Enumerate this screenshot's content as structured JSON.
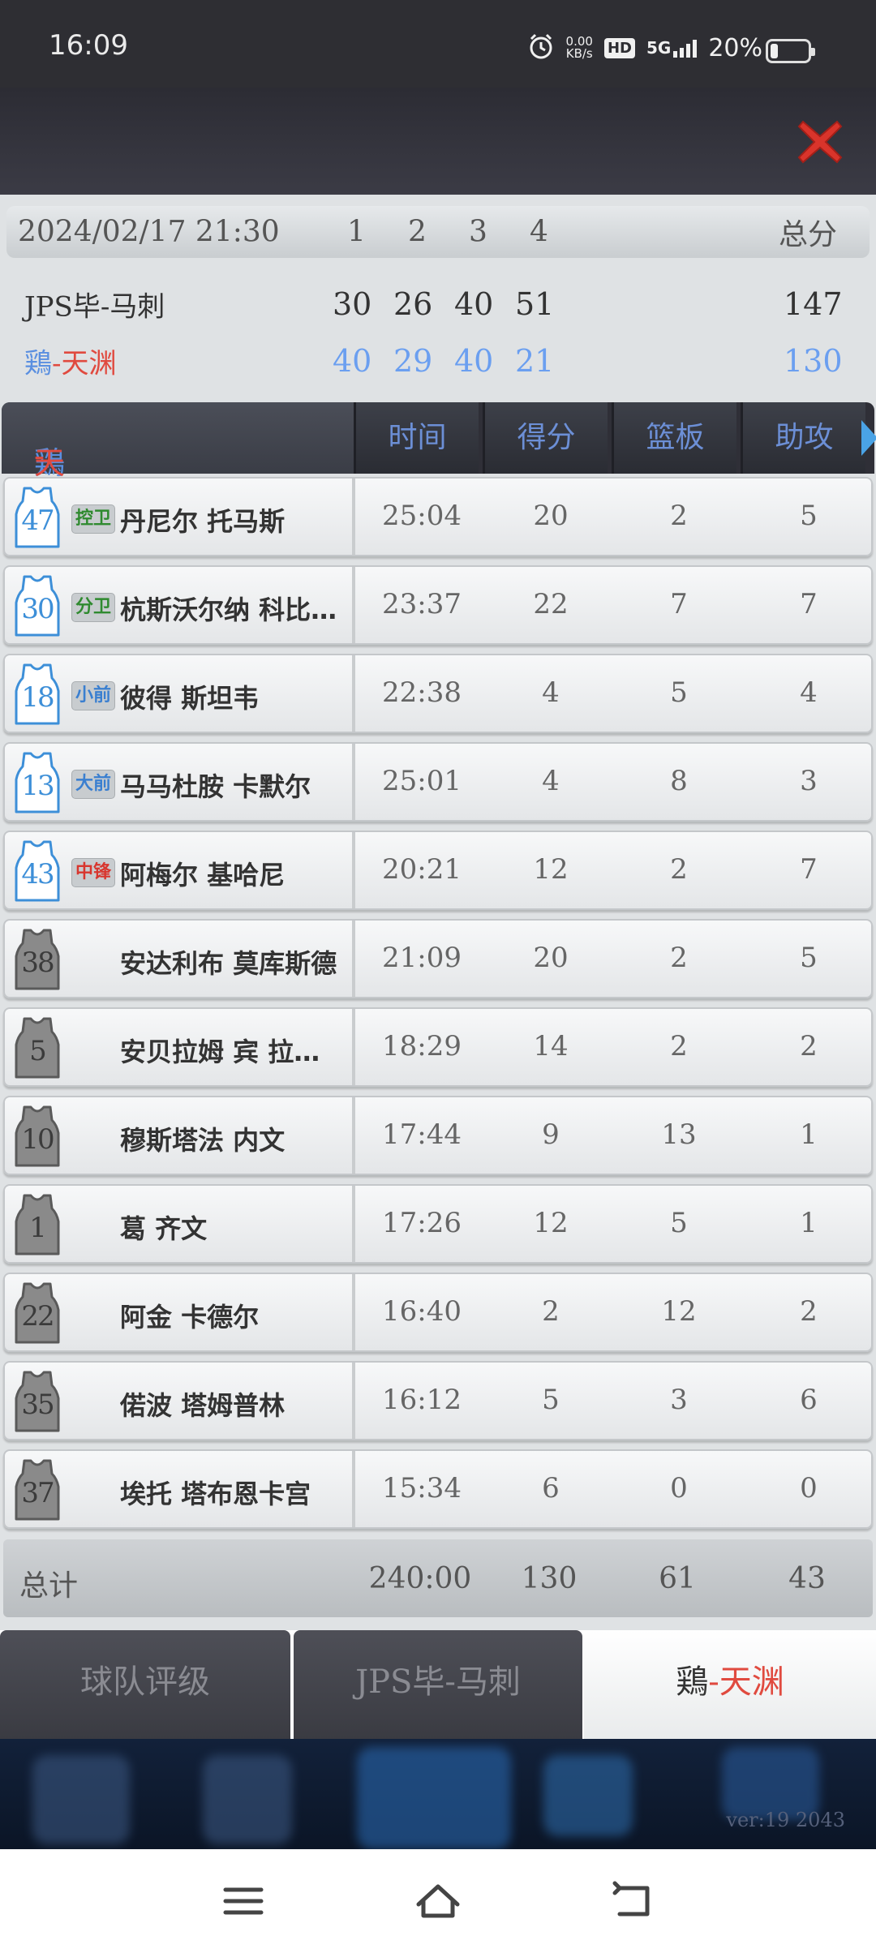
{
  "status_bar": {
    "time": "16:09",
    "net_speed_value": "0.00",
    "net_speed_unit": "KB/s",
    "hd_label": "HD",
    "network": "5G",
    "battery_text": "20%",
    "battery_level": 0.2
  },
  "scoreboard": {
    "datetime": "2024/02/17 21:30",
    "quarters": [
      "1",
      "2",
      "3",
      "4"
    ],
    "total_label": "总分",
    "team_a": {
      "prefix": "JPS毕",
      "sep": "-",
      "name": "马刺",
      "q": [
        "30",
        "26",
        "40",
        "51"
      ],
      "total": "147"
    },
    "team_b": {
      "prefix": "鶏",
      "sep": "-",
      "name": "天渊",
      "q": [
        "40",
        "29",
        "40",
        "21"
      ],
      "total": "130"
    }
  },
  "table": {
    "team_prefix": "鶏",
    "team_sep": "-",
    "team_name": "天渊",
    "columns": [
      "时间",
      "得分",
      "篮板",
      "助攻"
    ],
    "players": [
      {
        "number": "47",
        "pos": "控卫",
        "name": "丹尼尔  托马斯",
        "time": "25:04",
        "pts": "20",
        "reb": "2",
        "ast": "5"
      },
      {
        "number": "30",
        "pos": "分卫",
        "name": "杭斯沃尔纳  科比…",
        "time": "23:37",
        "pts": "22",
        "reb": "7",
        "ast": "7"
      },
      {
        "number": "18",
        "pos": "小前",
        "name": "彼得  斯坦韦",
        "time": "22:38",
        "pts": "4",
        "reb": "5",
        "ast": "4"
      },
      {
        "number": "13",
        "pos": "大前",
        "name": "马马杜胺  卡默尔",
        "time": "25:01",
        "pts": "4",
        "reb": "8",
        "ast": "3"
      },
      {
        "number": "43",
        "pos": "中锋",
        "name": "阿梅尔  基哈尼",
        "time": "20:21",
        "pts": "12",
        "reb": "2",
        "ast": "7"
      },
      {
        "number": "38",
        "pos": "",
        "name": "安达利布  莫库斯德",
        "time": "21:09",
        "pts": "20",
        "reb": "2",
        "ast": "5"
      },
      {
        "number": "5",
        "pos": "",
        "name": "安贝拉姆  宾  拉…",
        "time": "18:29",
        "pts": "14",
        "reb": "2",
        "ast": "2"
      },
      {
        "number": "10",
        "pos": "",
        "name": "穆斯塔法  内文",
        "time": "17:44",
        "pts": "9",
        "reb": "13",
        "ast": "1"
      },
      {
        "number": "1",
        "pos": "",
        "name": "葛  齐文",
        "time": "17:26",
        "pts": "12",
        "reb": "5",
        "ast": "1"
      },
      {
        "number": "22",
        "pos": "",
        "name": "阿金  卡德尔",
        "time": "16:40",
        "pts": "2",
        "reb": "12",
        "ast": "2"
      },
      {
        "number": "35",
        "pos": "",
        "name": "偌波  塔姆普林",
        "time": "16:12",
        "pts": "5",
        "reb": "3",
        "ast": "6"
      },
      {
        "number": "37",
        "pos": "",
        "name": "埃托  塔布恩卡宫",
        "time": "15:34",
        "pts": "6",
        "reb": "0",
        "ast": "0"
      }
    ],
    "totals": {
      "label": "总计",
      "time": "240:00",
      "pts": "130",
      "reb": "61",
      "ast": "43"
    }
  },
  "tabs": {
    "team_rating": "球队评级",
    "team_a_prefix": "JPS毕",
    "team_a_sep": "-",
    "team_a_name": "马刺",
    "team_b_prefix": "鶏",
    "team_b_sep": "-",
    "team_b_name": "天渊"
  },
  "footer": {
    "version": "ver:19 2043"
  },
  "colors": {
    "accent_red": "#e04a3f",
    "accent_blue": "#5a8fe0",
    "header_dark": "#2f2f37"
  }
}
